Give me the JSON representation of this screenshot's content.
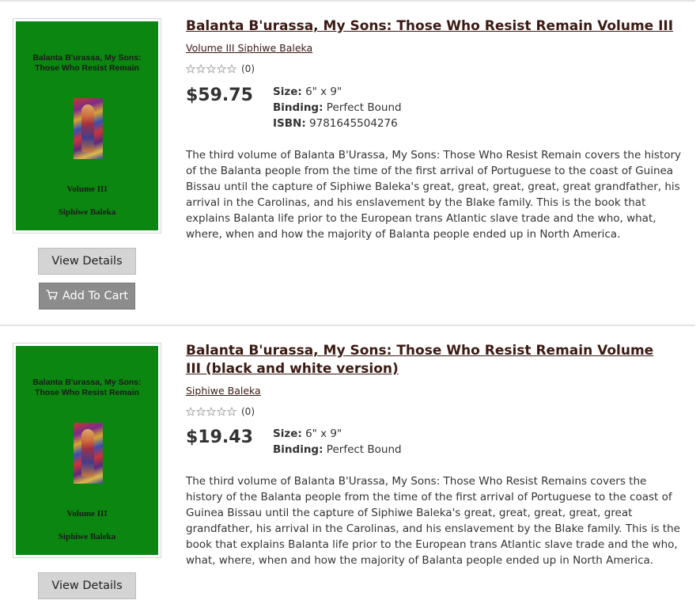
{
  "products": [
    {
      "cover": {
        "title": "Balanta B'urassa, My Sons: Those Who Resist Remain",
        "volume": "Volume III",
        "author": "Siphiwe Baleka"
      },
      "title": "Balanta B'urassa, My Sons: Those Who Resist Remain Volume III",
      "subline": "Volume III Siphiwe Baleka",
      "rating_stars": 0,
      "rating_count": "(0)",
      "price": "$59.75",
      "specs": {
        "size_label": "Size:",
        "size_value": "6\" x 9\"",
        "binding_label": "Binding:",
        "binding_value": "Perfect Bound",
        "isbn_label": "ISBN:",
        "isbn_value": "9781645504276"
      },
      "description": "The third volume of Balanta B'Urassa, My Sons: Those Who Resist Remain covers the history of the Balanta people from the time of the first arrival of Portuguese to the coast of Guinea Bissau until the capture of Siphiwe Baleka's great, great, great, great, great grandfather, his arrival in the Carolinas, and his enslavement by the Blake family. This is the book that explains Balanta life prior to the European trans Atlantic slave trade and the who, what, where, when and how the majority of Balanta people ended up in North America.",
      "view_details_label": "View Details",
      "add_to_cart_label": "Add To Cart"
    },
    {
      "cover": {
        "title": "Balanta B'urassa, My Sons: Those Who Resist Remain",
        "volume": "Volume III",
        "author": "Siphiwe Baleka"
      },
      "title": "Balanta B'urassa, My Sons: Those Who Resist Remain Volume III (black and white version)",
      "subline": "Siphiwe Baleka",
      "rating_stars": 0,
      "rating_count": "(0)",
      "price": "$19.43",
      "specs": {
        "size_label": "Size:",
        "size_value": "6\" x 9\"",
        "binding_label": "Binding:",
        "binding_value": "Perfect Bound"
      },
      "description": "The third volume of Balanta B'Urassa, My Sons: Those Who Resist Remains covers the history of the Balanta people from the time of the first arrival of Portuguese to the coast of Guinea Bissau until the capture of Siphiwe Baleka's great, great, great, great, great grandfather, his arrival in the Carolinas, and his enslavement by the Blake family. This is the book that explains Balanta life prior to the European trans Atlantic slave trade and the who, what, where, when and how the majority of Balanta people ended up in North America.",
      "view_details_label": "View Details"
    }
  ],
  "colors": {
    "cover_green": "#0b8610",
    "title_link": "#3b1a12",
    "button_gray": "#d4d4d4",
    "cart_button": "#8c8c8c"
  }
}
